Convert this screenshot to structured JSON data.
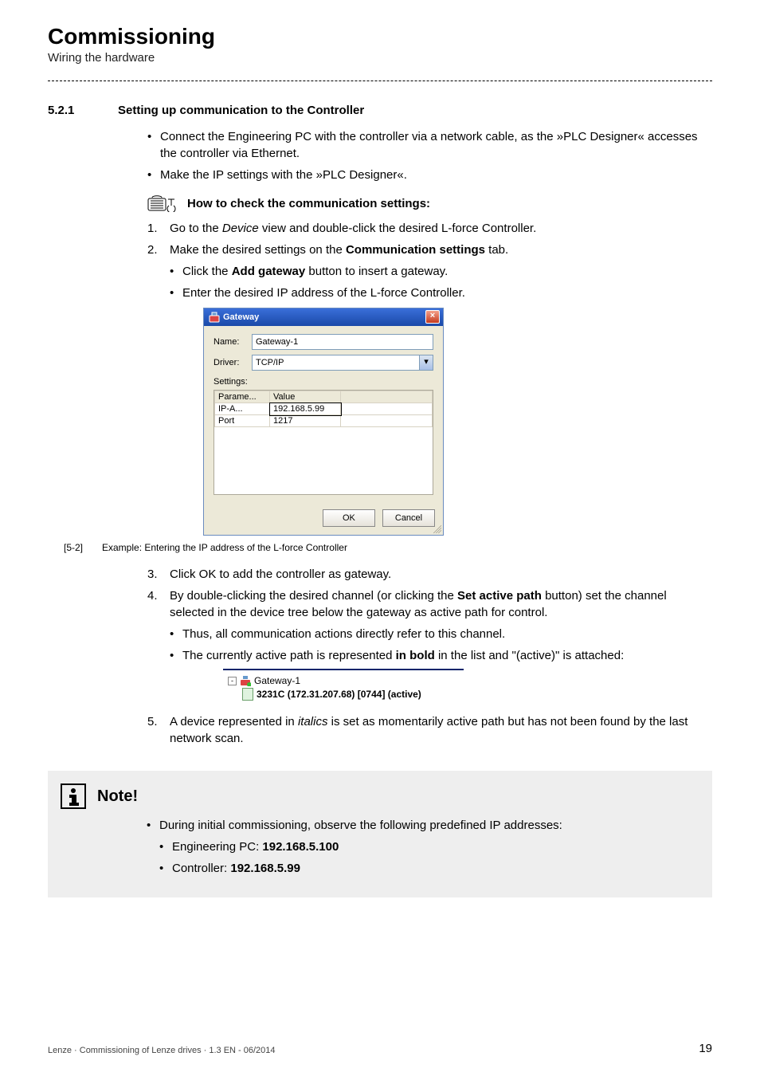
{
  "header": {
    "title": "Commissioning",
    "subtitle": "Wiring the hardware"
  },
  "section": {
    "number": "5.2.1",
    "heading": "Setting up communication to the Controller",
    "bullets": [
      "Connect the Engineering PC with the controller via a network cable, as the »PLC Designer« accesses the controller via Ethernet.",
      "Make the IP settings with the »PLC Designer«."
    ]
  },
  "howto": {
    "heading": "How to check the communication settings:",
    "steps": [
      {
        "italic": "Device",
        "rest": "view and double-click the desired L-force Controller."
      },
      {
        "pre": "Make the desired settings on the",
        "bold": "Communication settings",
        "post": "tab.",
        "sub": [
          {
            "pre": "Click the",
            "bold": "Add gateway",
            "post": "button to insert a gateway."
          },
          {
            "text": "Enter the desired IP address of the L-force Controller."
          }
        ]
      },
      {
        "text": "Click OK to add the controller as gateway."
      },
      {
        "pre": "By double-clicking the desired channel (or clicking the",
        "bold": "Set active path",
        "post": "button) set the channel selected in the device tree below the gateway as active path for control.",
        "sub": [
          "Thus, all communication actions directly refer to this channel."
        ],
        "sub_rich": {
          "pre": "The currently active path is represented",
          "bold": "in bold",
          "post": "in the list and \"(active)\" is attached:"
        }
      },
      {
        "pre": "A device represented in",
        "italic": "italics",
        "post": "is set as momentarily active path but has not been found by the last network scan."
      }
    ]
  },
  "dialog": {
    "title": "Gateway",
    "name_label": "Name:",
    "name_value": "Gateway-1",
    "driver_label": "Driver:",
    "driver_value": "TCP/IP",
    "settings_label": "Settings:",
    "table": {
      "headers": [
        "Parame...",
        "Value"
      ],
      "rows": [
        [
          "IP-A...",
          "192.168.5.99"
        ],
        [
          "Port",
          "1217"
        ]
      ]
    },
    "ok": "OK",
    "cancel": "Cancel"
  },
  "figure": {
    "number": "[5-2]",
    "caption": "Example: Entering the IP address of the L-force Controller"
  },
  "tree": {
    "gateway": "Gateway-1",
    "device": "3231C (172.31.207.68) [0744] (active)"
  },
  "note": {
    "title": "Note!",
    "lines": [
      "During initial commissioning, observe the following predefined IP addresses:",
      {
        "pre": "Engineering PC:",
        "bold": "192.168.5.100"
      },
      {
        "pre": "Controller:",
        "bold": "192.168.5.99"
      }
    ]
  },
  "footer": {
    "text": "Lenze · Commissioning of Lenze drives · 1.3 EN - 06/2014",
    "page": "19"
  }
}
